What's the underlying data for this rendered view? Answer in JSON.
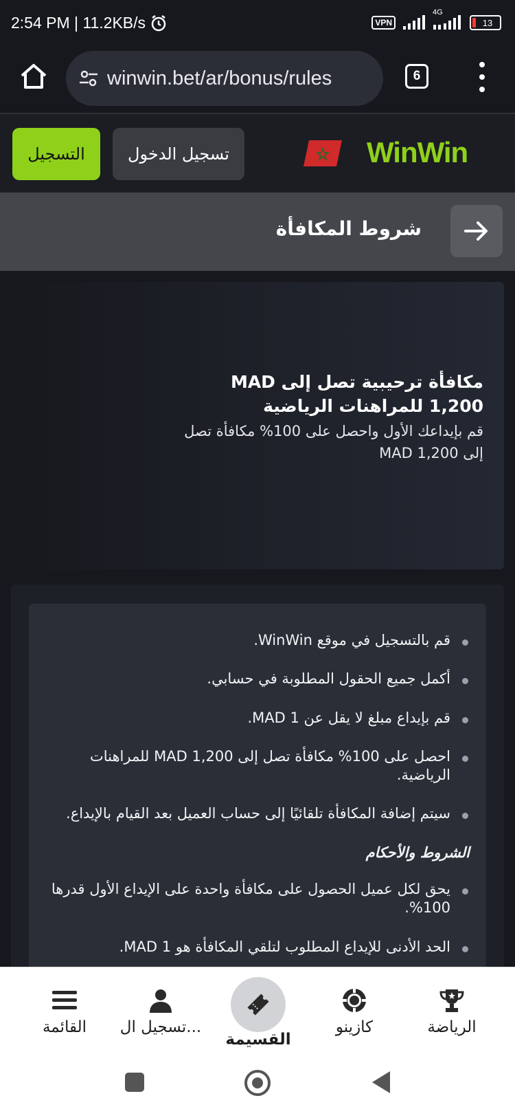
{
  "status_bar": {
    "time_speed": "2:54 PM | 11.2KB/s",
    "vpn": "VPN",
    "network": "4G",
    "battery": "13"
  },
  "browser": {
    "url": "winwin.bet/ar/bonus/rules",
    "tab_count": "6"
  },
  "header": {
    "register_label": "التسجيل",
    "login_label": "تسجيل الدخول",
    "logo": "WinWin",
    "accent_color": "#8fd11a"
  },
  "page": {
    "title": "شروط المكافأة"
  },
  "hero": {
    "title": "مكافأة ترحيبية تصل إلى MAD 1,200 للمراهنات الرياضية",
    "subtitle": "قم بإيداعك الأول واحصل على 100% مكافأة تصل إلى MAD 1,200"
  },
  "rules": {
    "items": [
      "قم بالتسجيل في موقع WinWin.",
      "أكمل جميع الحقول المطلوبة في حسابي.",
      "قم بإيداع مبلغ لا يقل عن MAD 1.",
      "احصل على 100% مكافأة تصل إلى MAD 1,200 للمراهنات الرياضية.",
      "سيتم إضافة المكافأة تلقائيًا إلى حساب العميل بعد القيام بالإيداع."
    ],
    "terms_heading": "الشروط والأحكام",
    "terms": [
      "يحق لكل عميل الحصول على مكافأة واحدة على الإيداع الأول قدرها 100%.",
      "الحد الأدنى للإيداع المطلوب لتلقي المكافأة هو MAD 1."
    ]
  },
  "bottom_nav": {
    "sports": "الرياضة",
    "casino": "كازينو",
    "coupon": "القسيمة",
    "account": "تسجيل ال...",
    "menu": "القائمة"
  }
}
